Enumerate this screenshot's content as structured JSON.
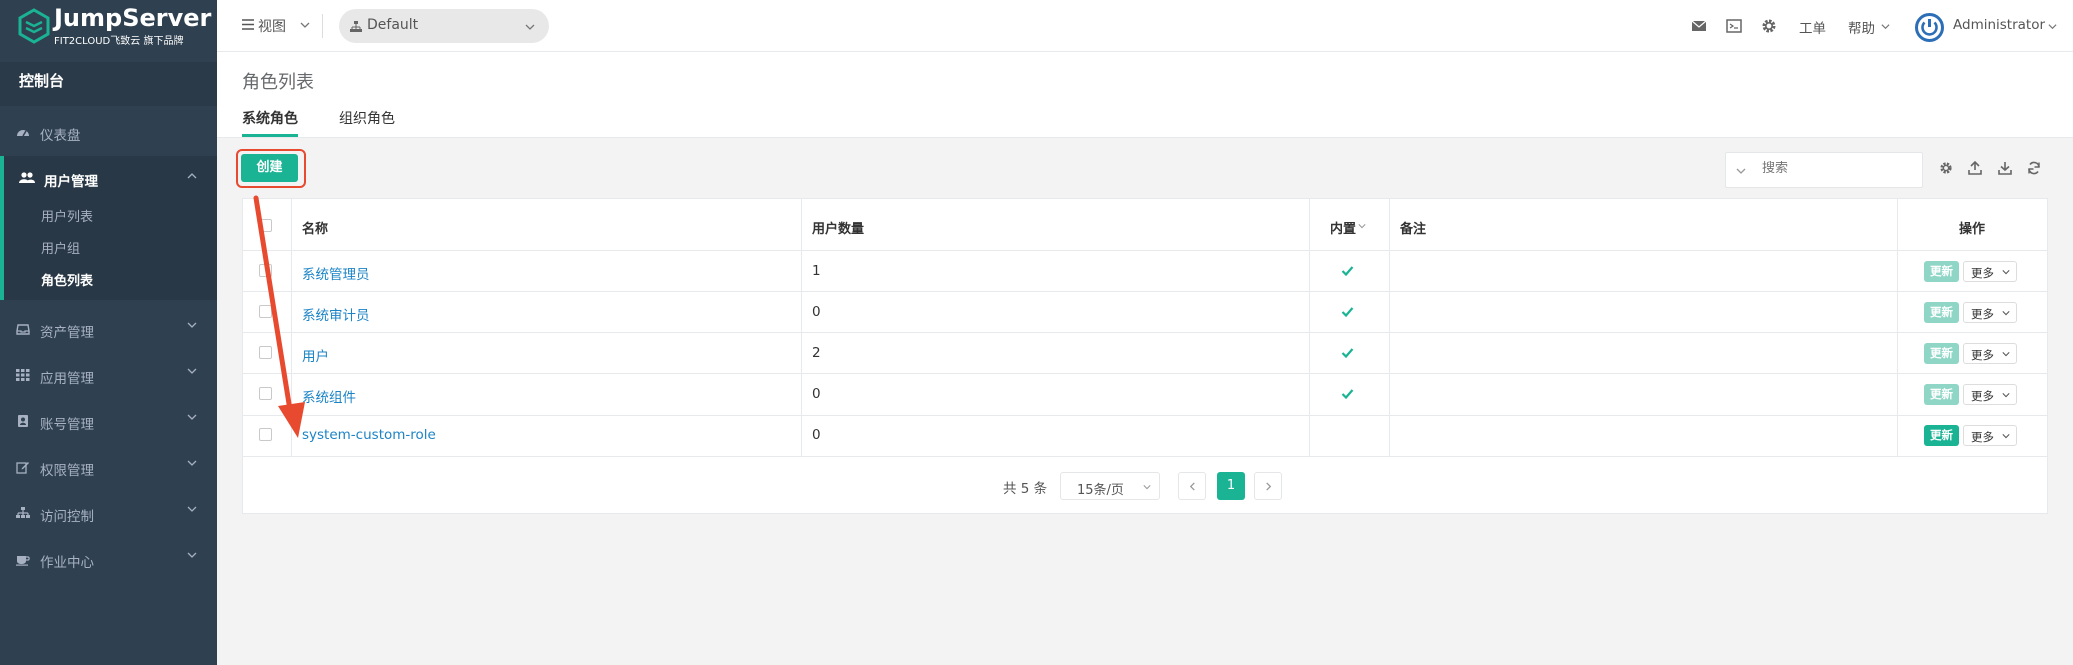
{
  "brand": {
    "title": "JumpServer",
    "subtitle": "FIT2CLOUD飞致云 旗下品牌"
  },
  "sidebar": {
    "console": "控制台",
    "items": [
      {
        "label": "仪表盘",
        "icon": "dashboard-icon"
      },
      {
        "label": "用户管理",
        "icon": "users-icon",
        "expanded": true,
        "children": [
          {
            "label": "用户列表"
          },
          {
            "label": "用户组"
          },
          {
            "label": "角色列表",
            "active": true
          }
        ]
      },
      {
        "label": "资产管理",
        "icon": "inbox-icon"
      },
      {
        "label": "应用管理",
        "icon": "grid-icon"
      },
      {
        "label": "账号管理",
        "icon": "contact-card-icon"
      },
      {
        "label": "权限管理",
        "icon": "edit-icon"
      },
      {
        "label": "访问控制",
        "icon": "sitemap-icon"
      },
      {
        "label": "作业中心",
        "icon": "coffee-icon"
      }
    ]
  },
  "header": {
    "view": "视图",
    "org": "Default",
    "ticket": "工单",
    "help": "帮助",
    "user": "Administrator"
  },
  "page": {
    "title": "角色列表",
    "tabs": [
      {
        "label": "系统角色",
        "active": true
      },
      {
        "label": "组织角色"
      }
    ]
  },
  "toolbar": {
    "create_label": "创建",
    "search_placeholder": "搜索"
  },
  "table": {
    "columns": [
      "名称",
      "用户数量",
      "内置",
      "备注",
      "操作"
    ],
    "rows": [
      {
        "name": "系统管理员",
        "users": "1",
        "builtin": true,
        "remark": ""
      },
      {
        "name": "系统审计员",
        "users": "0",
        "builtin": true,
        "remark": ""
      },
      {
        "name": "用户",
        "users": "2",
        "builtin": true,
        "remark": ""
      },
      {
        "name": "系统组件",
        "users": "0",
        "builtin": true,
        "remark": ""
      },
      {
        "name": "system-custom-role",
        "users": "0",
        "builtin": false,
        "remark": ""
      }
    ],
    "update_label": "更新",
    "more_label": "更多"
  },
  "pagination": {
    "total": "共 5 条",
    "page_size": "15条/页",
    "current": "1"
  },
  "colors": {
    "primary": "#1ab394",
    "primary_disabled": "#8fd6c6",
    "sidebar": "#2f4050",
    "link": "#1c84c6",
    "annotation": "#e84a2f"
  }
}
